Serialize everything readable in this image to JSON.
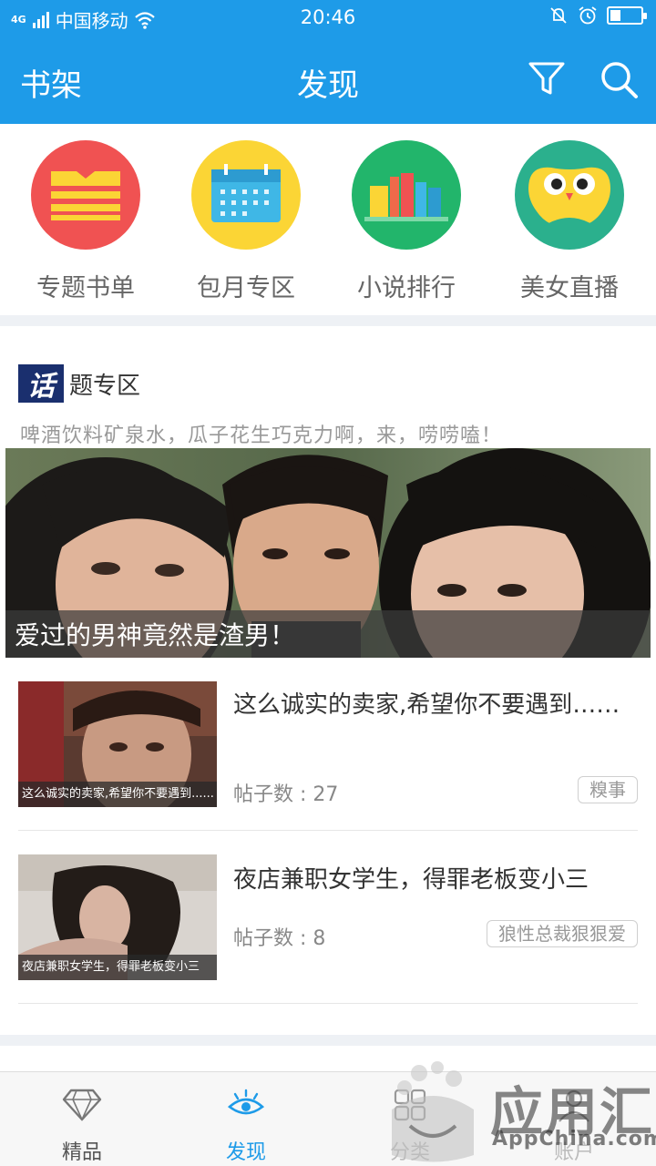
{
  "status_bar": {
    "network": "4G",
    "carrier": "中国移动",
    "time": "20:46",
    "battery_level": 0.35,
    "icons": [
      "signal-icon",
      "wifi-icon",
      "mute-icon",
      "alarm-icon",
      "battery-icon"
    ]
  },
  "app_bar": {
    "shelf_label": "书架",
    "title": "发现",
    "accent_color": "#1e9be8",
    "icons": [
      "filter-icon",
      "search-icon"
    ]
  },
  "categories": [
    {
      "label": "专题书单",
      "color": "#f05252",
      "icon": "book-icon"
    },
    {
      "label": "包月专区",
      "color": "#fbd535",
      "icon": "calendar-icon"
    },
    {
      "label": "小说排行",
      "color": "#22b56b",
      "icon": "ranking-bars-icon"
    },
    {
      "label": "美女直播",
      "color": "#2bb08d",
      "icon": "owl-face-icon"
    }
  ],
  "topic": {
    "badge": "话",
    "heading_rest": "题专区",
    "subtitle": "啤酒饮料矿泉水，瓜子花生巧克力啊，来，唠唠嗑！",
    "banner_caption": "爱过的男神竟然是渣男！"
  },
  "posts": [
    {
      "title": "这么诚实的卖家,希望你不要遇到……",
      "thumb_caption": "这么诚实的卖家,希望你不要遇到......",
      "count": "帖子数 : 27",
      "tag": "糗事"
    },
    {
      "title": "夜店兼职女学生，得罪老板变小三",
      "thumb_caption": "夜店兼职女学生，得罪老板变小三",
      "count": "帖子数 : 8",
      "tag": "狼性总裁狠狠爱"
    }
  ],
  "bottom_nav": [
    {
      "label": "精品",
      "icon": "diamond-icon",
      "active": false
    },
    {
      "label": "发现",
      "icon": "eye-icon",
      "active": true
    },
    {
      "label": "分类",
      "icon": "category-icon",
      "active": false
    },
    {
      "label": "账户",
      "icon": "account-icon",
      "active": false
    }
  ],
  "watermark": {
    "text": "应用汇",
    "sub": "AppChina.com"
  }
}
